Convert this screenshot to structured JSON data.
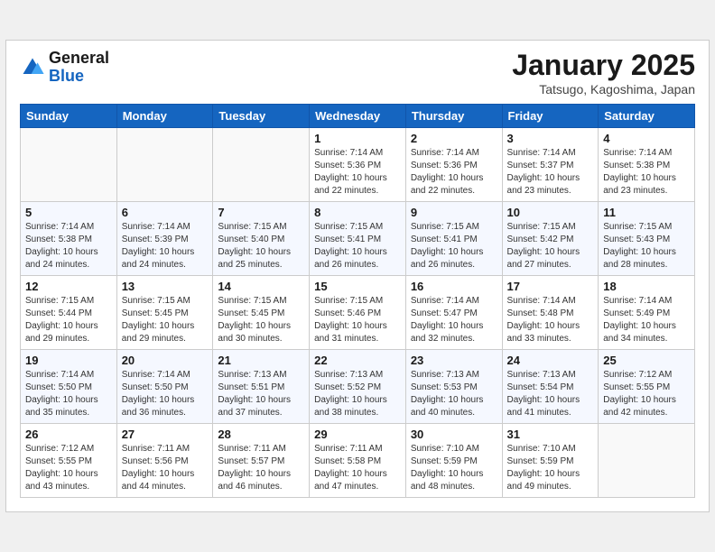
{
  "header": {
    "logo_line1": "General",
    "logo_line2": "Blue",
    "month_title": "January 2025",
    "subtitle": "Tatsugo, Kagoshima, Japan"
  },
  "weekdays": [
    "Sunday",
    "Monday",
    "Tuesday",
    "Wednesday",
    "Thursday",
    "Friday",
    "Saturday"
  ],
  "weeks": [
    [
      {
        "day": "",
        "info": ""
      },
      {
        "day": "",
        "info": ""
      },
      {
        "day": "",
        "info": ""
      },
      {
        "day": "1",
        "info": "Sunrise: 7:14 AM\nSunset: 5:36 PM\nDaylight: 10 hours\nand 22 minutes."
      },
      {
        "day": "2",
        "info": "Sunrise: 7:14 AM\nSunset: 5:36 PM\nDaylight: 10 hours\nand 22 minutes."
      },
      {
        "day": "3",
        "info": "Sunrise: 7:14 AM\nSunset: 5:37 PM\nDaylight: 10 hours\nand 23 minutes."
      },
      {
        "day": "4",
        "info": "Sunrise: 7:14 AM\nSunset: 5:38 PM\nDaylight: 10 hours\nand 23 minutes."
      }
    ],
    [
      {
        "day": "5",
        "info": "Sunrise: 7:14 AM\nSunset: 5:38 PM\nDaylight: 10 hours\nand 24 minutes."
      },
      {
        "day": "6",
        "info": "Sunrise: 7:14 AM\nSunset: 5:39 PM\nDaylight: 10 hours\nand 24 minutes."
      },
      {
        "day": "7",
        "info": "Sunrise: 7:15 AM\nSunset: 5:40 PM\nDaylight: 10 hours\nand 25 minutes."
      },
      {
        "day": "8",
        "info": "Sunrise: 7:15 AM\nSunset: 5:41 PM\nDaylight: 10 hours\nand 26 minutes."
      },
      {
        "day": "9",
        "info": "Sunrise: 7:15 AM\nSunset: 5:41 PM\nDaylight: 10 hours\nand 26 minutes."
      },
      {
        "day": "10",
        "info": "Sunrise: 7:15 AM\nSunset: 5:42 PM\nDaylight: 10 hours\nand 27 minutes."
      },
      {
        "day": "11",
        "info": "Sunrise: 7:15 AM\nSunset: 5:43 PM\nDaylight: 10 hours\nand 28 minutes."
      }
    ],
    [
      {
        "day": "12",
        "info": "Sunrise: 7:15 AM\nSunset: 5:44 PM\nDaylight: 10 hours\nand 29 minutes."
      },
      {
        "day": "13",
        "info": "Sunrise: 7:15 AM\nSunset: 5:45 PM\nDaylight: 10 hours\nand 29 minutes."
      },
      {
        "day": "14",
        "info": "Sunrise: 7:15 AM\nSunset: 5:45 PM\nDaylight: 10 hours\nand 30 minutes."
      },
      {
        "day": "15",
        "info": "Sunrise: 7:15 AM\nSunset: 5:46 PM\nDaylight: 10 hours\nand 31 minutes."
      },
      {
        "day": "16",
        "info": "Sunrise: 7:14 AM\nSunset: 5:47 PM\nDaylight: 10 hours\nand 32 minutes."
      },
      {
        "day": "17",
        "info": "Sunrise: 7:14 AM\nSunset: 5:48 PM\nDaylight: 10 hours\nand 33 minutes."
      },
      {
        "day": "18",
        "info": "Sunrise: 7:14 AM\nSunset: 5:49 PM\nDaylight: 10 hours\nand 34 minutes."
      }
    ],
    [
      {
        "day": "19",
        "info": "Sunrise: 7:14 AM\nSunset: 5:50 PM\nDaylight: 10 hours\nand 35 minutes."
      },
      {
        "day": "20",
        "info": "Sunrise: 7:14 AM\nSunset: 5:50 PM\nDaylight: 10 hours\nand 36 minutes."
      },
      {
        "day": "21",
        "info": "Sunrise: 7:13 AM\nSunset: 5:51 PM\nDaylight: 10 hours\nand 37 minutes."
      },
      {
        "day": "22",
        "info": "Sunrise: 7:13 AM\nSunset: 5:52 PM\nDaylight: 10 hours\nand 38 minutes."
      },
      {
        "day": "23",
        "info": "Sunrise: 7:13 AM\nSunset: 5:53 PM\nDaylight: 10 hours\nand 40 minutes."
      },
      {
        "day": "24",
        "info": "Sunrise: 7:13 AM\nSunset: 5:54 PM\nDaylight: 10 hours\nand 41 minutes."
      },
      {
        "day": "25",
        "info": "Sunrise: 7:12 AM\nSunset: 5:55 PM\nDaylight: 10 hours\nand 42 minutes."
      }
    ],
    [
      {
        "day": "26",
        "info": "Sunrise: 7:12 AM\nSunset: 5:55 PM\nDaylight: 10 hours\nand 43 minutes."
      },
      {
        "day": "27",
        "info": "Sunrise: 7:11 AM\nSunset: 5:56 PM\nDaylight: 10 hours\nand 44 minutes."
      },
      {
        "day": "28",
        "info": "Sunrise: 7:11 AM\nSunset: 5:57 PM\nDaylight: 10 hours\nand 46 minutes."
      },
      {
        "day": "29",
        "info": "Sunrise: 7:11 AM\nSunset: 5:58 PM\nDaylight: 10 hours\nand 47 minutes."
      },
      {
        "day": "30",
        "info": "Sunrise: 7:10 AM\nSunset: 5:59 PM\nDaylight: 10 hours\nand 48 minutes."
      },
      {
        "day": "31",
        "info": "Sunrise: 7:10 AM\nSunset: 5:59 PM\nDaylight: 10 hours\nand 49 minutes."
      },
      {
        "day": "",
        "info": ""
      }
    ]
  ]
}
